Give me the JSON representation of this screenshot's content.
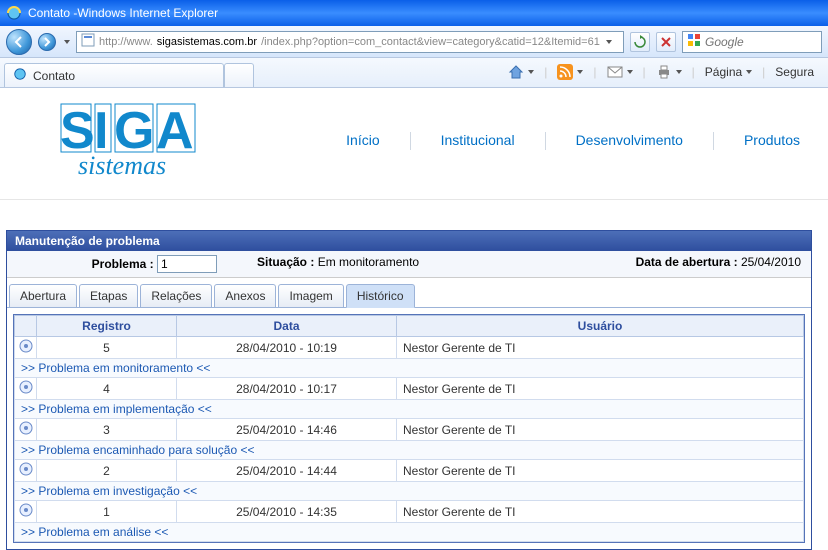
{
  "window": {
    "title": "Contato -Windows Internet Explorer",
    "url_prefix": "http://www.",
    "url_host": "sigasistemas.com.br",
    "url_path": "/index.php?option=com_contact&view=category&catid=12&Itemid=61",
    "search_placeholder": "Google"
  },
  "tab": {
    "title": "Contato"
  },
  "cmdbar": {
    "page": "Página",
    "safety": "Segura"
  },
  "nav": {
    "items": [
      "Início",
      "Institucional",
      "Desenvolvimento",
      "Produtos"
    ]
  },
  "module": {
    "title": "Manutenção de problema",
    "problema_label": "Problema :",
    "problema_value": "1",
    "situacao_label": "Situação :",
    "situacao_value": "Em monitoramento",
    "abertura_label": "Data de abertura :",
    "abertura_value": "25/04/2010"
  },
  "apptabs": [
    "Abertura",
    "Etapas",
    "Relações",
    "Anexos",
    "Imagem",
    "Histórico"
  ],
  "grid": {
    "headers": [
      "Registro",
      "Data",
      "Usuário"
    ],
    "rows": [
      {
        "type": "data",
        "reg": "5",
        "data": "28/04/2010 - 10:19",
        "user": "Nestor Gerente de TI"
      },
      {
        "type": "status",
        "text": ">> Problema em monitoramento <<"
      },
      {
        "type": "data",
        "reg": "4",
        "data": "28/04/2010 - 10:17",
        "user": "Nestor Gerente de TI"
      },
      {
        "type": "status",
        "text": ">> Problema em implementação <<"
      },
      {
        "type": "data",
        "reg": "3",
        "data": "25/04/2010 - 14:46",
        "user": "Nestor Gerente de TI"
      },
      {
        "type": "status",
        "text": ">> Problema encaminhado para solução <<"
      },
      {
        "type": "data",
        "reg": "2",
        "data": "25/04/2010 - 14:44",
        "user": "Nestor Gerente de TI"
      },
      {
        "type": "status",
        "text": ">> Problema em investigação <<"
      },
      {
        "type": "data",
        "reg": "1",
        "data": "25/04/2010 - 14:35",
        "user": "Nestor Gerente de TI"
      },
      {
        "type": "status",
        "text": ">> Problema em análise <<"
      }
    ]
  }
}
